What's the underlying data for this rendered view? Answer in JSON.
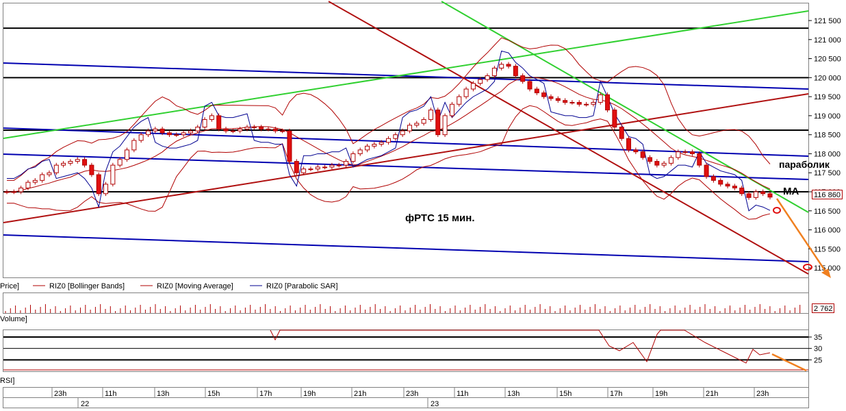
{
  "chart_data": [
    {
      "type": "candlestick",
      "pane": "price",
      "ylim": [
        114750,
        121950
      ],
      "y_ticks": [
        {
          "v": 121500,
          "label": "121 500"
        },
        {
          "v": 121000,
          "label": "121 000"
        },
        {
          "v": 120500,
          "label": "120 500"
        },
        {
          "v": 120000,
          "label": "120 000"
        },
        {
          "v": 119500,
          "label": "119 500"
        },
        {
          "v": 119000,
          "label": "119 000"
        },
        {
          "v": 118500,
          "label": "118 500"
        },
        {
          "v": 118000,
          "label": "118 000"
        },
        {
          "v": 117500,
          "label": "117 500"
        },
        {
          "v": 117000,
          "label": "117 000"
        },
        {
          "v": 116500,
          "label": "116 500"
        },
        {
          "v": 116000,
          "label": "116 000"
        },
        {
          "v": 115500,
          "label": "115 500"
        },
        {
          "v": 115000,
          "label": "115 000"
        }
      ],
      "last_price_label": "116 860",
      "last_price": 116860,
      "horizontal_levels": [
        121300,
        120000,
        118620,
        117000
      ],
      "annotations": {
        "title": "фРТС   15 мин.",
        "parabolic": "параболик",
        "ma": "МА"
      },
      "legend": [
        "Price]",
        "RIZ0 [Bollinger Bands]",
        "RIZ0 [Moving Average]",
        "RIZ0 [Parabolic SAR]"
      ],
      "series_close_path": [
        117000,
        117000,
        117100,
        117250,
        117300,
        117450,
        117500,
        117700,
        117750,
        117800,
        117850,
        117700,
        117450,
        116950,
        117200,
        117700,
        117850,
        118100,
        118350,
        118500,
        118600,
        118650,
        118550,
        118500,
        118500,
        118550,
        118600,
        118700,
        118900,
        119000,
        118650,
        118600,
        118600,
        118650,
        118700,
        118700,
        118650,
        118650,
        118600,
        118600,
        117800,
        117500,
        117600,
        117600,
        117650,
        117650,
        117700,
        117700,
        117800,
        118000,
        118100,
        118200,
        118250,
        118300,
        118400,
        118500,
        118600,
        118750,
        118800,
        118900,
        119150,
        118500,
        119000,
        119300,
        119500,
        119700,
        119850,
        119950,
        120050,
        120250,
        120350,
        120300,
        120050,
        119900,
        119700,
        119600,
        119500,
        119450,
        119400,
        119350,
        119350,
        119300,
        119300,
        119350,
        119550,
        119150,
        118700,
        118400,
        118100,
        118050,
        117900,
        117800,
        117700,
        117750,
        117900,
        118050,
        118050,
        118000,
        117700,
        117400,
        117300,
        117200,
        117150,
        117100,
        116950,
        116850,
        117000,
        116950,
        116860
      ]
    },
    {
      "type": "bar",
      "pane": "volume",
      "label": "Volume]",
      "last_value_label": "2 762"
    },
    {
      "type": "line",
      "pane": "rsi",
      "label": "RSI]",
      "y_ticks": [
        {
          "v": 35,
          "label": "35"
        },
        {
          "v": 30,
          "label": "30"
        },
        {
          "v": 25,
          "label": "25"
        }
      ],
      "ylim": [
        20,
        38
      ]
    }
  ],
  "time_axis": {
    "hour_labels": [
      "23h",
      "11h",
      "13h",
      "15h",
      "17h",
      "19h",
      "21h",
      "23h",
      "11h",
      "13h",
      "15h",
      "17h",
      "19h",
      "21h",
      "23h"
    ],
    "date_labels": [
      "22",
      "23"
    ]
  }
}
